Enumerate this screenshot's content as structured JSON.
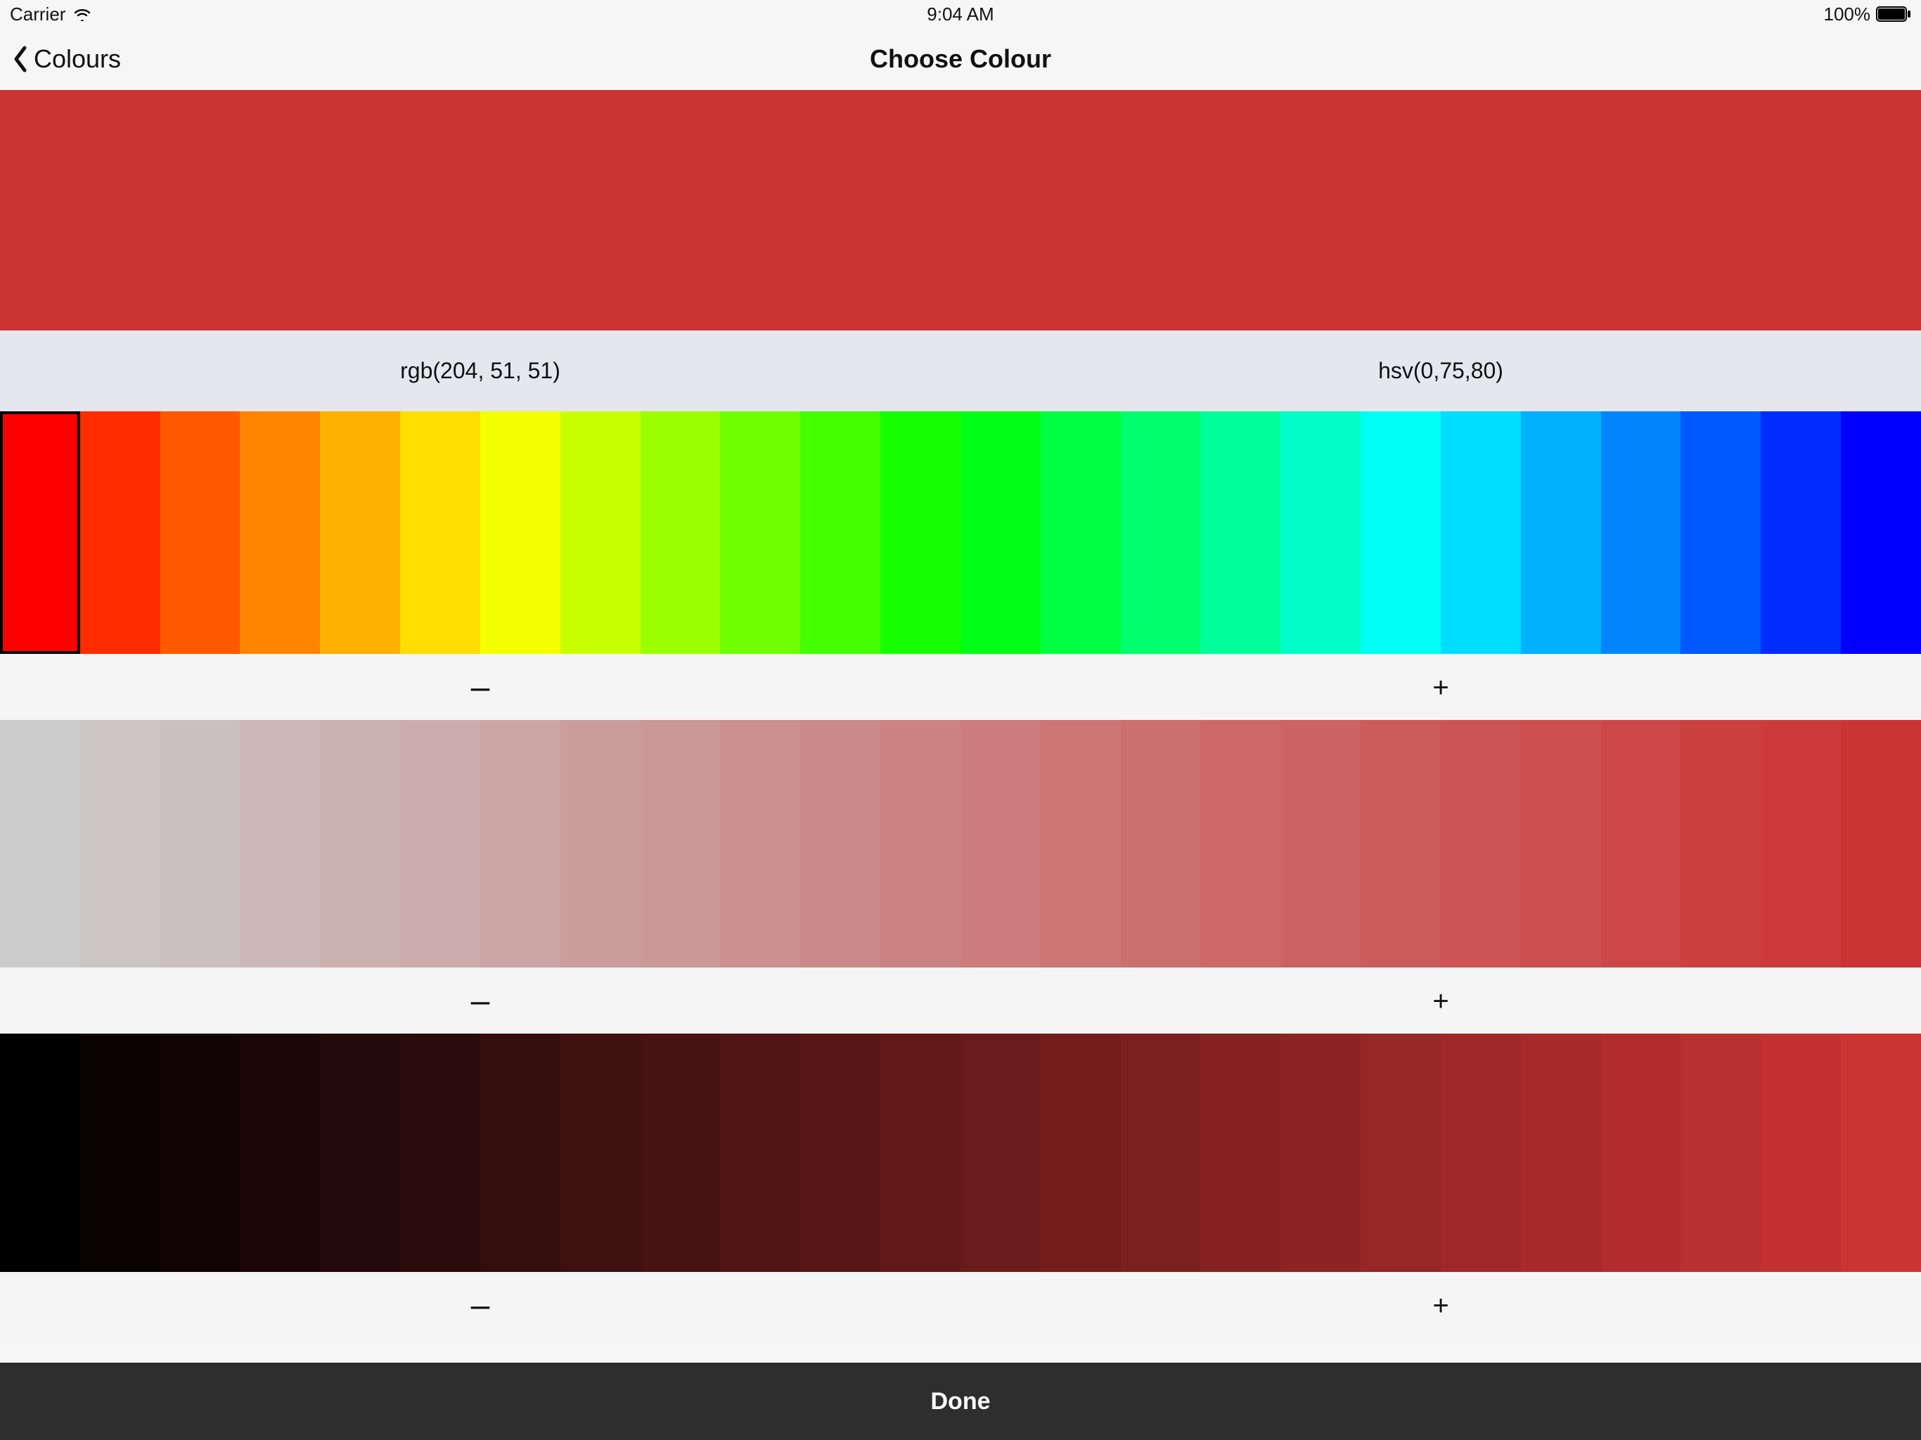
{
  "status_bar": {
    "carrier": "Carrier",
    "time": "9:04 AM",
    "battery_pct": "100%"
  },
  "nav": {
    "back_label": "Colours",
    "title": "Choose Colour"
  },
  "selected_color": {
    "hex": "#cc3333",
    "rgb_text": "rgb(204, 51, 51)",
    "hsv_text": "hsv(0,75,80)",
    "h": 0,
    "s": 75,
    "v": 80
  },
  "hue_row": {
    "swatch_count": 24,
    "selected_index": 0
  },
  "sat_row": {
    "swatch_count": 24,
    "selected_index": -1
  },
  "val_row": {
    "swatch_count": 24,
    "selected_index": -1
  },
  "controls": {
    "minus_glyph": "–",
    "plus_glyph": "+"
  },
  "footer": {
    "done_label": "Done"
  }
}
